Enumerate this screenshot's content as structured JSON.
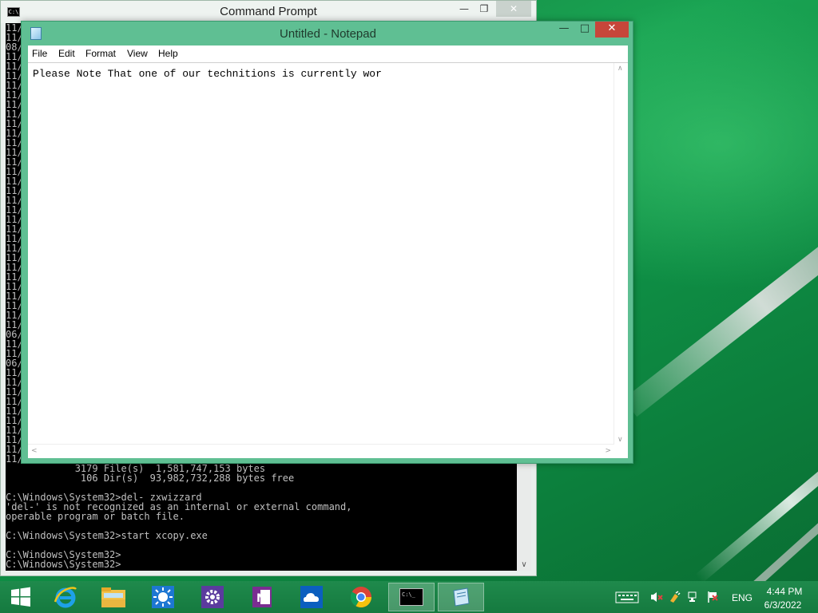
{
  "cmd": {
    "title": "Command Prompt",
    "left_column": [
      "11/",
      "11/",
      "08/",
      "11/",
      "11/",
      "11/",
      "11/",
      "11/",
      "11/",
      "11/",
      "11/",
      "11/",
      "11/",
      "11/",
      "11/",
      "11/",
      "11/",
      "11/",
      "11/",
      "11/",
      "11/",
      "11/",
      "11/",
      "11/",
      "11/",
      "11/",
      "11/",
      "11/",
      "11/",
      "11/",
      "11/",
      "11/",
      "06/",
      "11/",
      "11/",
      "06/",
      "11/",
      "11/",
      "11/",
      "11/",
      "11/",
      "11/",
      "11/",
      "11/",
      "11/",
      "11/"
    ],
    "lines": [
      "            3179 File(s)  1,581,747,153 bytes",
      "             106 Dir(s)  93,982,732,288 bytes free",
      "",
      "C:\\Windows\\System32>del- zxwizzard",
      "'del-' is not recognized as an internal or external command,",
      "operable program or batch file.",
      "",
      "C:\\Windows\\System32>start xcopy.exe",
      "",
      "C:\\Windows\\System32>",
      "C:\\Windows\\System32>"
    ]
  },
  "notepad": {
    "title": "Untitled - Notepad",
    "menu": [
      "File",
      "Edit",
      "Format",
      "View",
      "Help"
    ],
    "content": "Please Note That one of our technitions is currently wor"
  },
  "taskbar": {
    "apps": [
      "start-icon",
      "internet-explorer-icon",
      "file-explorer-icon",
      "weather-icon",
      "settings-icon",
      "onenote-icon",
      "onedrive-icon",
      "chrome-icon",
      "command-prompt-icon",
      "notepad-icon"
    ],
    "language": "ENG",
    "time": "4:44 PM",
    "date": "6/3/2022"
  },
  "colors": {
    "notepad_frame": "#5fbf93",
    "close_button": "#c7463a",
    "taskbar": "#1f8a4c"
  }
}
